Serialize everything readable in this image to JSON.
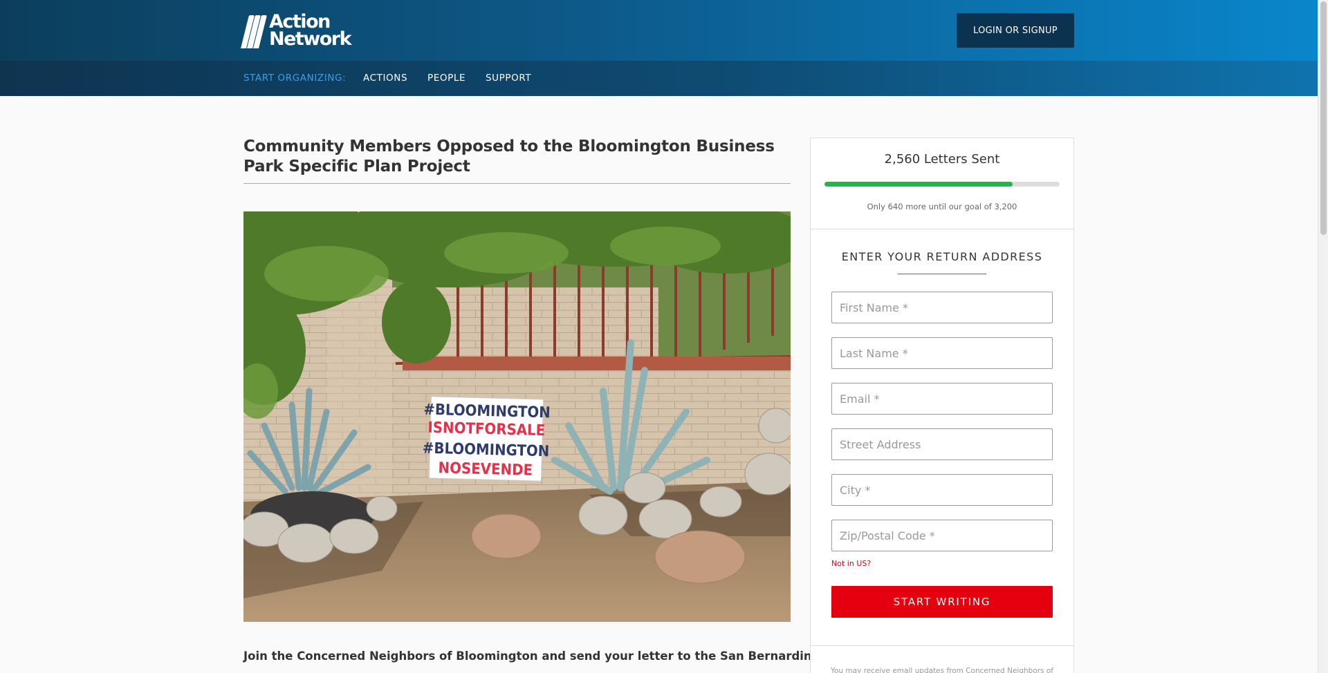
{
  "header": {
    "logo_line1": "Action",
    "logo_line2": "Network",
    "login_label": "LOGIN OR SIGNUP"
  },
  "nav": {
    "lead": "START ORGANIZING:",
    "items": [
      "ACTIONS",
      "PEOPLE",
      "SUPPORT"
    ]
  },
  "main": {
    "title": "Community Members Opposed to the Bloomington Business Park Specific Plan Project",
    "image_sign_lines": [
      "#BLOOMINGTON",
      "ISNOTFORSALE",
      "#BLOOMINGTON",
      "NOSEVENDE"
    ],
    "intro_text": "Join the Concerned Neighbors of Bloomington and send your letter to the San Bernardino County"
  },
  "progress": {
    "title": "2,560 Letters Sent",
    "fraction": 0.8,
    "note": "Only 640 more until our goal of 3,200"
  },
  "form": {
    "heading": "ENTER YOUR RETURN ADDRESS",
    "first_name_placeholder": "First Name *",
    "last_name_placeholder": "Last Name *",
    "email_placeholder": "Email *",
    "street_placeholder": "Street Address",
    "city_placeholder": "City *",
    "zip_placeholder": "Zip/Postal Code *",
    "not_in_us": "Not in US?",
    "submit_label": "START WRITING",
    "disclaimer": "You may receive email updates from Concerned Neighbors of"
  },
  "colors": {
    "header_dark": "#0c3e5c",
    "header_light": "#0a86cc",
    "nav_lead": "#3aa0e6",
    "progress_fill": "#1cb84a",
    "submit": "#e4000f",
    "not_in_us": "#d0021b"
  }
}
